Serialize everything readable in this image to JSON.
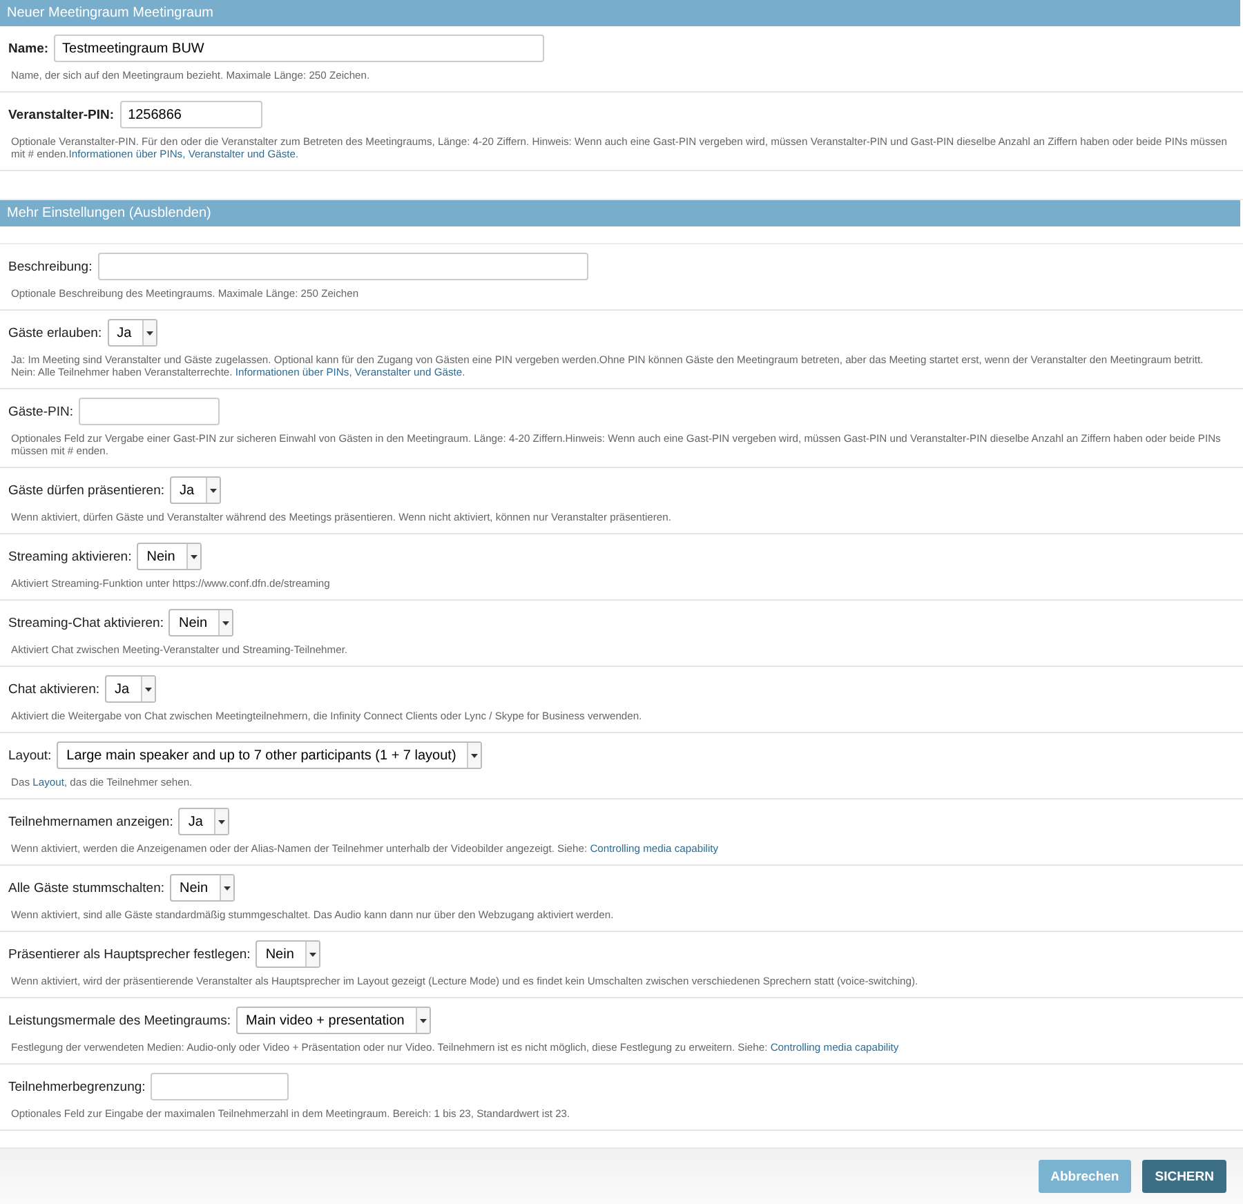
{
  "sections": [
    {
      "title": "Neuer Meetingraum Meetingraum",
      "bold_labels": true,
      "fields": [
        {
          "label": "Name:",
          "kind": "text",
          "value": "Testmeetingraum BUW",
          "help": [
            [
              {
                "kind": "text",
                "text": "Name, der sich auf den Meetingraum bezieht. Maximale Länge: 250 Zeichen."
              }
            ]
          ]
        },
        {
          "label": "Veranstalter-PIN:",
          "kind": "text",
          "value": "1256866",
          "help": [
            [
              {
                "kind": "text",
                "text": "Optionale Veranstalter-PIN. Für den oder die Veranstalter zum Betreten des Meetingraums, Länge: 4-20 Ziffern. Hinweis: Wenn auch eine Gast-PIN vergeben wird, müssen Veranstalter-PIN und Gast-PIN dieselbe Anzahl an Ziffern haben oder beide PINs müssen mit # enden."
              },
              {
                "kind": "link",
                "text": "Informationen über PINs, Veranstalter und Gäste."
              }
            ]
          ]
        }
      ]
    },
    {
      "title": "Mehr Einstellungen (Ausblenden)",
      "bold_labels": false,
      "fields": [
        {
          "label": "Beschreibung:",
          "kind": "text",
          "help": [
            [
              {
                "kind": "text",
                "text": "Optionale Beschreibung des Meetingraums. Maximale Länge: 250 Zeichen"
              }
            ]
          ]
        },
        {
          "label": "Gäste erlauben:",
          "kind": "select",
          "value": "Ja",
          "help": [
            [
              {
                "kind": "text",
                "text": "Ja: Im Meeting sind Veranstalter und Gäste zugelassen. Optional kann für den Zugang von Gästen eine PIN vergeben werden.Ohne PIN können Gäste den Meetingraum betreten, aber das Meeting startet erst, wenn der Veranstalter den Meetingraum betritt."
              }
            ],
            [
              {
                "kind": "text",
                "text": "Nein: Alle Teilnehmer haben Veranstalterrechte. "
              },
              {
                "kind": "link",
                "text": "Informationen über PINs, Veranstalter und Gäste."
              }
            ]
          ]
        },
        {
          "label": "Gäste-PIN:",
          "kind": "text",
          "help": [
            [
              {
                "kind": "text",
                "text": "Optionales Feld zur Vergabe einer Gast-PIN zur sicheren Einwahl von Gästen in den Meetingraum. Länge: 4-20 Ziffern.Hinweis: Wenn auch eine Gast-PIN vergeben wird, müssen Gast-PIN und Veranstalter-PIN dieselbe Anzahl an Ziffern haben oder beide PINs müssen mit # enden."
              }
            ]
          ]
        },
        {
          "label": "Gäste dürfen präsentieren:",
          "kind": "select",
          "value": "Ja",
          "help": [
            [
              {
                "kind": "text",
                "text": "Wenn aktiviert, dürfen Gäste und Veranstalter während des Meetings präsentieren. Wenn nicht aktiviert, können nur Veranstalter präsentieren."
              }
            ]
          ]
        },
        {
          "label": "Streaming aktivieren:",
          "kind": "select",
          "value": "Nein",
          "help": [
            [
              {
                "kind": "text",
                "text": "Aktiviert Streaming-Funktion unter https://www.conf.dfn.de/streaming"
              }
            ]
          ]
        },
        {
          "label": "Streaming-Chat aktivieren:",
          "kind": "select",
          "value": "Nein",
          "help": [
            [
              {
                "kind": "text",
                "text": "Aktiviert Chat zwischen Meeting-Veranstalter und Streaming-Teilnehmer."
              }
            ]
          ]
        },
        {
          "label": "Chat aktivieren:",
          "kind": "select",
          "value": "Ja",
          "help": [
            [
              {
                "kind": "text",
                "text": "Aktiviert die Weitergabe von Chat zwischen Meetingteilnehmern, die Infinity Connect Clients oder Lync / Skype for Business verwenden."
              }
            ]
          ]
        },
        {
          "label": "Layout:",
          "kind": "select",
          "value": "Large main speaker and up to 7 other participants (1 + 7 layout)",
          "help": [
            [
              {
                "kind": "text",
                "text": "Das "
              },
              {
                "kind": "link",
                "text": "Layout"
              },
              {
                "kind": "text",
                "text": ", das die Teilnehmer sehen."
              }
            ]
          ]
        },
        {
          "label": "Teilnehmernamen anzeigen:",
          "kind": "select",
          "value": "Ja",
          "help": [
            [
              {
                "kind": "text",
                "text": "Wenn aktiviert, werden die Anzeigenamen oder der Alias-Namen der Teilnehmer unterhalb der Videobilder angezeigt. Siehe: "
              },
              {
                "kind": "link",
                "text": "Controlling media capability"
              }
            ]
          ]
        },
        {
          "label": "Alle Gäste stummschalten:",
          "kind": "select",
          "value": "Nein",
          "help": [
            [
              {
                "kind": "text",
                "text": "Wenn aktiviert, sind alle Gäste standardmäßig stummgeschaltet. Das Audio kann dann nur über den Webzugang aktiviert werden."
              }
            ]
          ]
        },
        {
          "label": "Präsentierer als Hauptsprecher festlegen:",
          "kind": "select",
          "value": "Nein",
          "help": [
            [
              {
                "kind": "text",
                "text": "Wenn aktiviert, wird der präsentierende Veranstalter als Hauptsprecher im Layout gezeigt (Lecture Mode) und es findet kein Umschalten zwischen verschiedenen Sprechern statt (voice-switching)."
              }
            ]
          ]
        },
        {
          "label": "Leistungsmermale des Meetingraums:",
          "kind": "select",
          "value": "Main video + presentation",
          "help": [
            [
              {
                "kind": "text",
                "text": "Festlegung der verwendeten Medien: Audio-only oder Video + Präsentation oder nur Video. Teilnehmern ist es nicht möglich, diese Festlegung zu erweitern. Siehe: "
              },
              {
                "kind": "link",
                "text": "Controlling media capability"
              }
            ]
          ]
        },
        {
          "label": "Teilnehmerbegrenzung:",
          "kind": "text",
          "help": [
            [
              {
                "kind": "text",
                "text": "Optionales Feld zur Eingabe der maximalen Teilnehmerzahl in dem Meetingraum. Bereich: 1 bis 23, Standardwert ist 23."
              }
            ]
          ]
        }
      ]
    }
  ],
  "buttons": [
    {
      "label": "Abbrechen",
      "kind": "secondary"
    },
    {
      "label": "SICHERN",
      "kind": "primary"
    }
  ]
}
